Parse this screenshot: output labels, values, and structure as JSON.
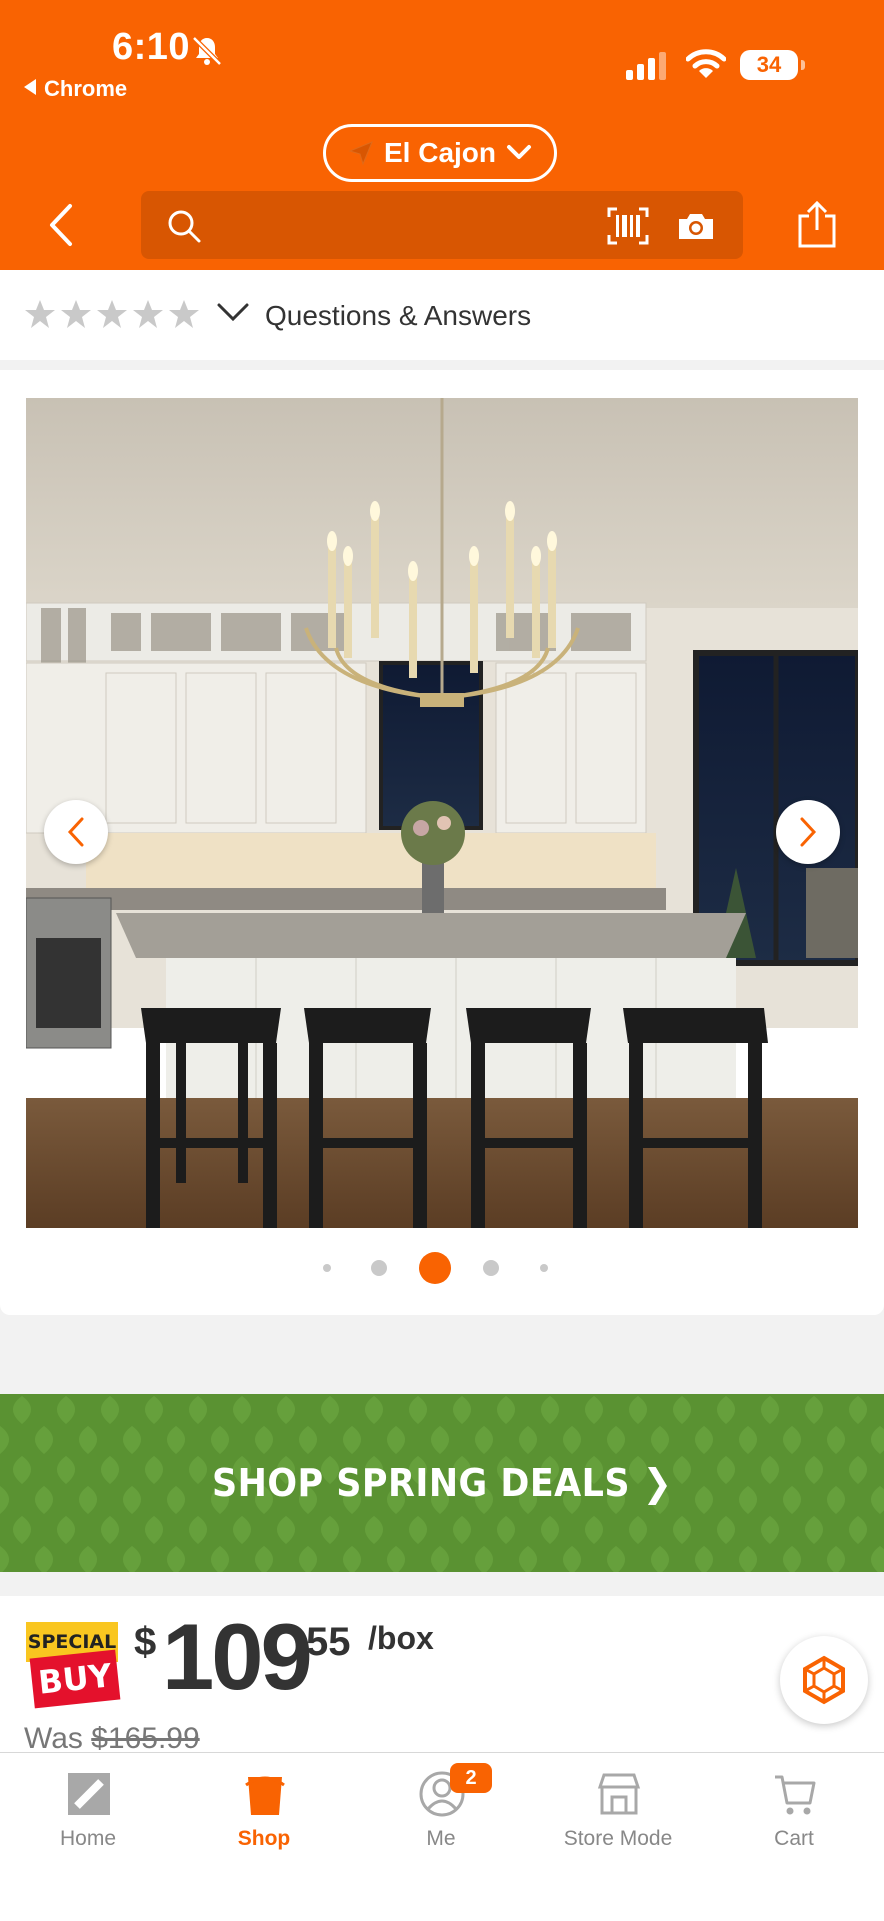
{
  "status_bar": {
    "time": "6:10",
    "back_app_label": "Chrome",
    "battery": "34"
  },
  "header": {
    "location": "El Cajon",
    "search_placeholder": ""
  },
  "rating": {
    "stars_filled": 0,
    "stars_total": 5,
    "qa_label": "Questions & Answers"
  },
  "gallery": {
    "image_alt": "Gold candle-style chandelier above white kitchen island with four black stools",
    "dot_count": 5,
    "active_dot": 2
  },
  "promo": {
    "text": "SHOP SPRING DEALS ❯"
  },
  "price": {
    "badge_top": "SPECIAL",
    "badge_bottom": "BUY",
    "dollar_sign": "$",
    "dollars": "109",
    "cents": "55",
    "unit": "/box",
    "was_label": "Was",
    "was_value": "$165.99"
  },
  "tabbar": {
    "tabs": [
      {
        "label": "Home"
      },
      {
        "label": "Shop"
      },
      {
        "label": "Me"
      },
      {
        "label": "Store Mode"
      },
      {
        "label": "Cart"
      }
    ],
    "me_badge": "2"
  },
  "colors": {
    "brand_orange": "#f96302",
    "promo_green": "#5a9232",
    "special_yellow": "#f9c620",
    "special_red": "#e4112c"
  }
}
